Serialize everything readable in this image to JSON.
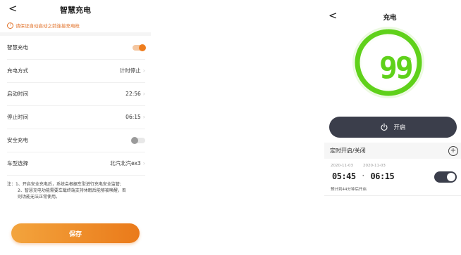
{
  "left": {
    "back_glyph": "<",
    "title": "智慧充电",
    "warning": "请保证自动启动之前连接充电枪",
    "rows": [
      {
        "label": "智慧充电",
        "switch": "on"
      },
      {
        "label": "充电方式",
        "value": "计时停止"
      },
      {
        "label": "启动时间",
        "value": "22:56"
      },
      {
        "label": "停止时间",
        "value": "06:15"
      },
      {
        "label": "安全充电",
        "switch": "off"
      },
      {
        "label": "车型选择",
        "value": "北汽北汽ex3"
      }
    ],
    "note_lines": [
      "注：1、开启安全充电后，系统会根据车型进行充电安全监管;",
      "2、智慧充电功能需要车载终端支持休眠后能够被唤醒，否",
      "则功能无法正常使用。"
    ],
    "save_label": "保存",
    "accent_color": "#ee7d1e"
  },
  "right": {
    "back_glyph": "<",
    "title": "充电",
    "percent": "99",
    "percent_unit": "%",
    "gauge_color": "#5fd11a",
    "power_button_label": "开启",
    "timer_header": "定时开启/关闭",
    "timer": {
      "start_date": "2020-11-03",
      "end_date": "2020-11-03",
      "start_time": "05:45",
      "separator": "·",
      "end_time": "06:15",
      "subtitle": "预计到44分钟后开启",
      "enabled": true
    }
  }
}
